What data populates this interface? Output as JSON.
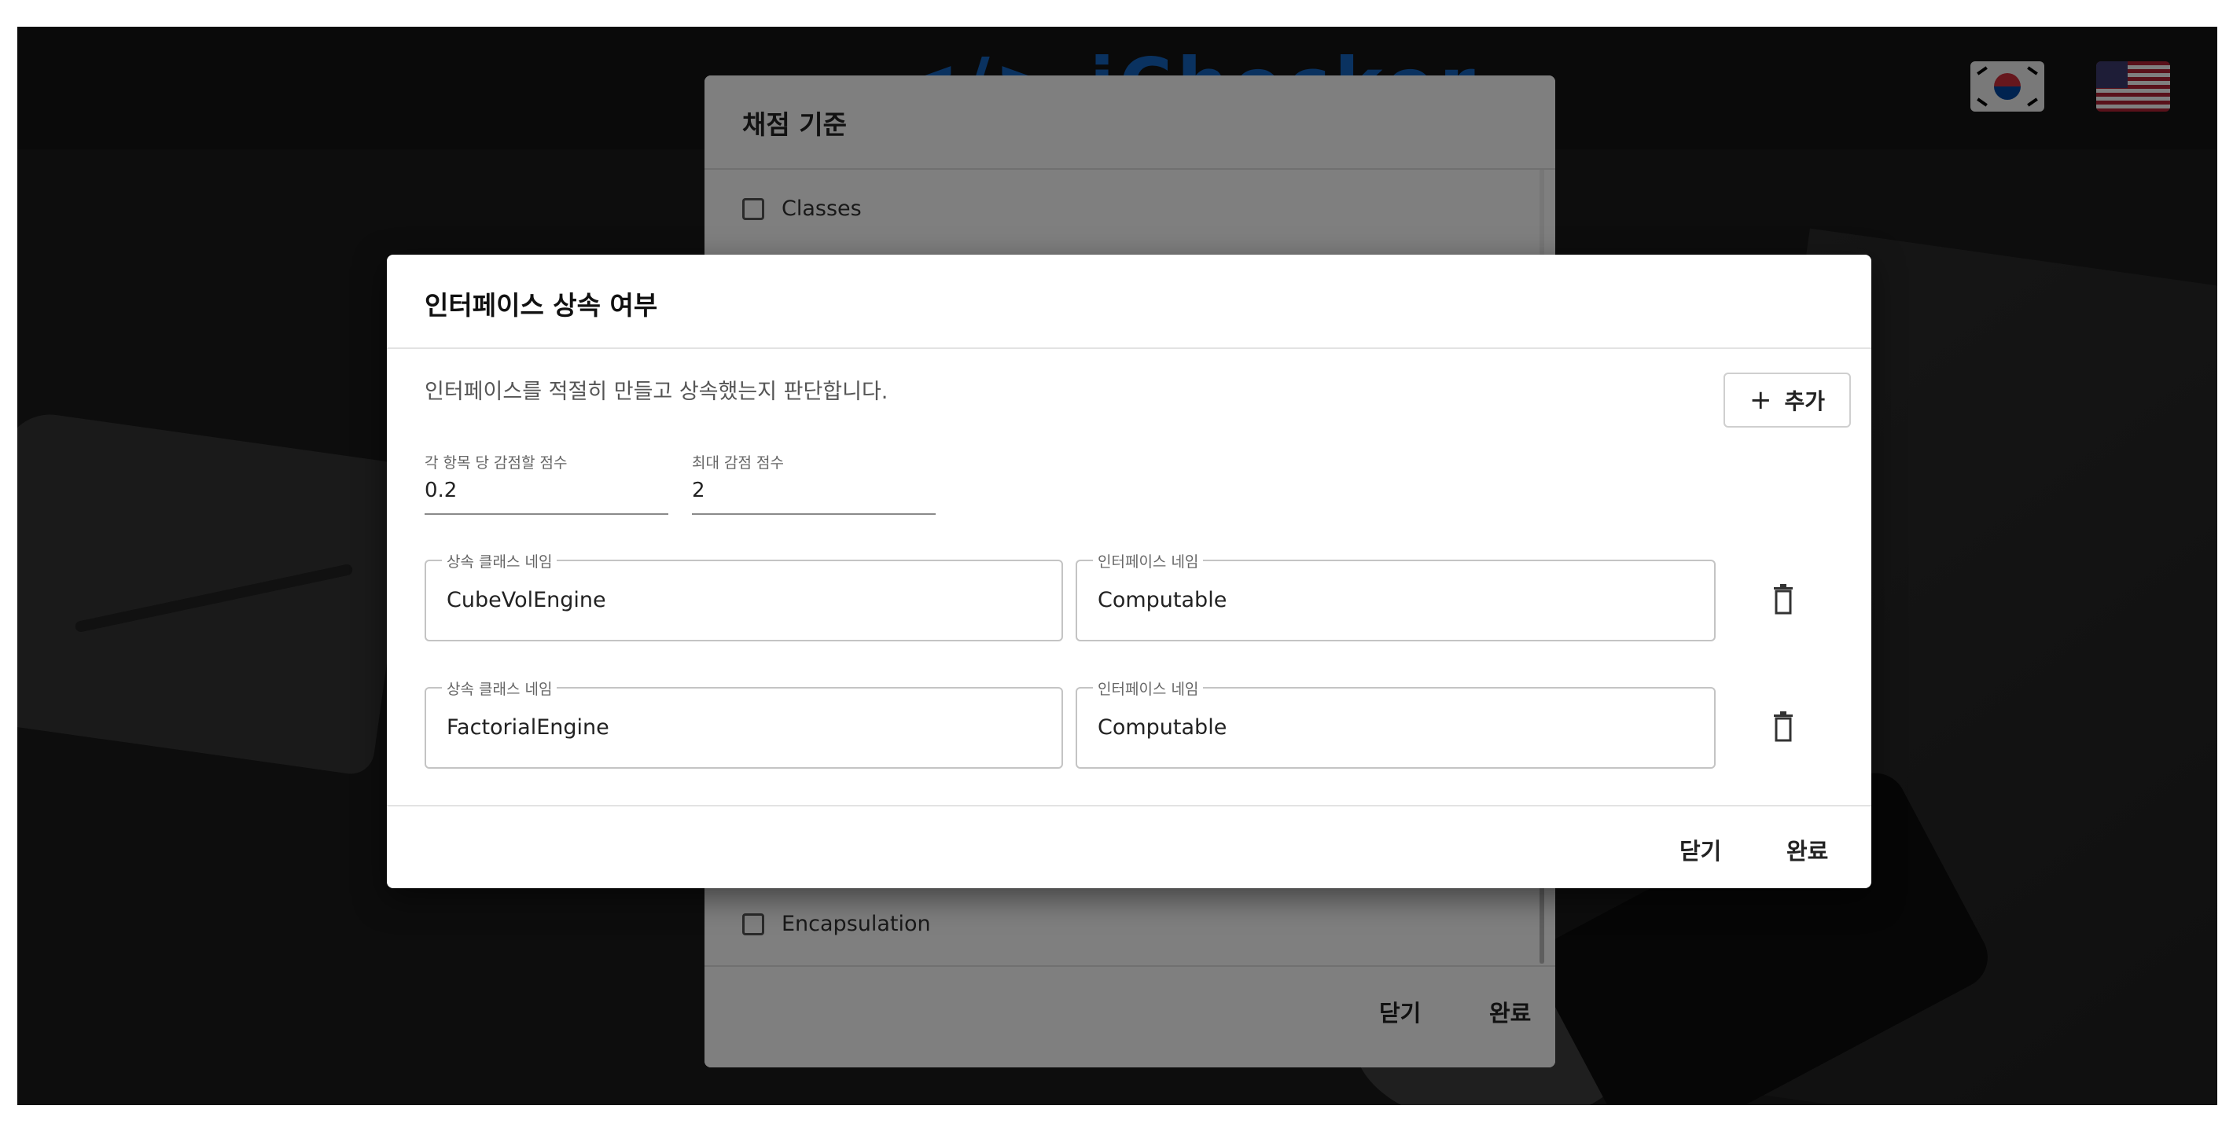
{
  "background": {
    "logo_text": "</> iChecker"
  },
  "language_flags": [
    {
      "name": "korean-flag"
    },
    {
      "name": "us-flag"
    }
  ],
  "back_dialog": {
    "title": "채점 기준",
    "items": [
      {
        "label": "Classes",
        "checked": false
      },
      {
        "label": "Encapsulation",
        "checked": false
      }
    ],
    "close_label": "닫기",
    "done_label": "완료"
  },
  "dialog": {
    "title": "인터페이스 상속 여부",
    "description": "인터페이스를 적절히 만들고 상속했는지 판단합니다.",
    "add_label": "추가",
    "fields": {
      "deduct_per_item_label": "각 항목 당 감점할 점수",
      "deduct_per_item_value": "0.2",
      "max_deduct_label": "최대 감점 점수",
      "max_deduct_value": "2"
    },
    "rows": [
      {
        "class_label": "상속 클래스 네임",
        "class_value": "CubeVolEngine",
        "interface_label": "인터페이스 네임",
        "interface_value": "Computable"
      },
      {
        "class_label": "상속 클래스 네임",
        "class_value": "FactorialEngine",
        "interface_label": "인터페이스 네임",
        "interface_value": "Computable"
      }
    ],
    "close_label": "닫기",
    "done_label": "완료"
  }
}
